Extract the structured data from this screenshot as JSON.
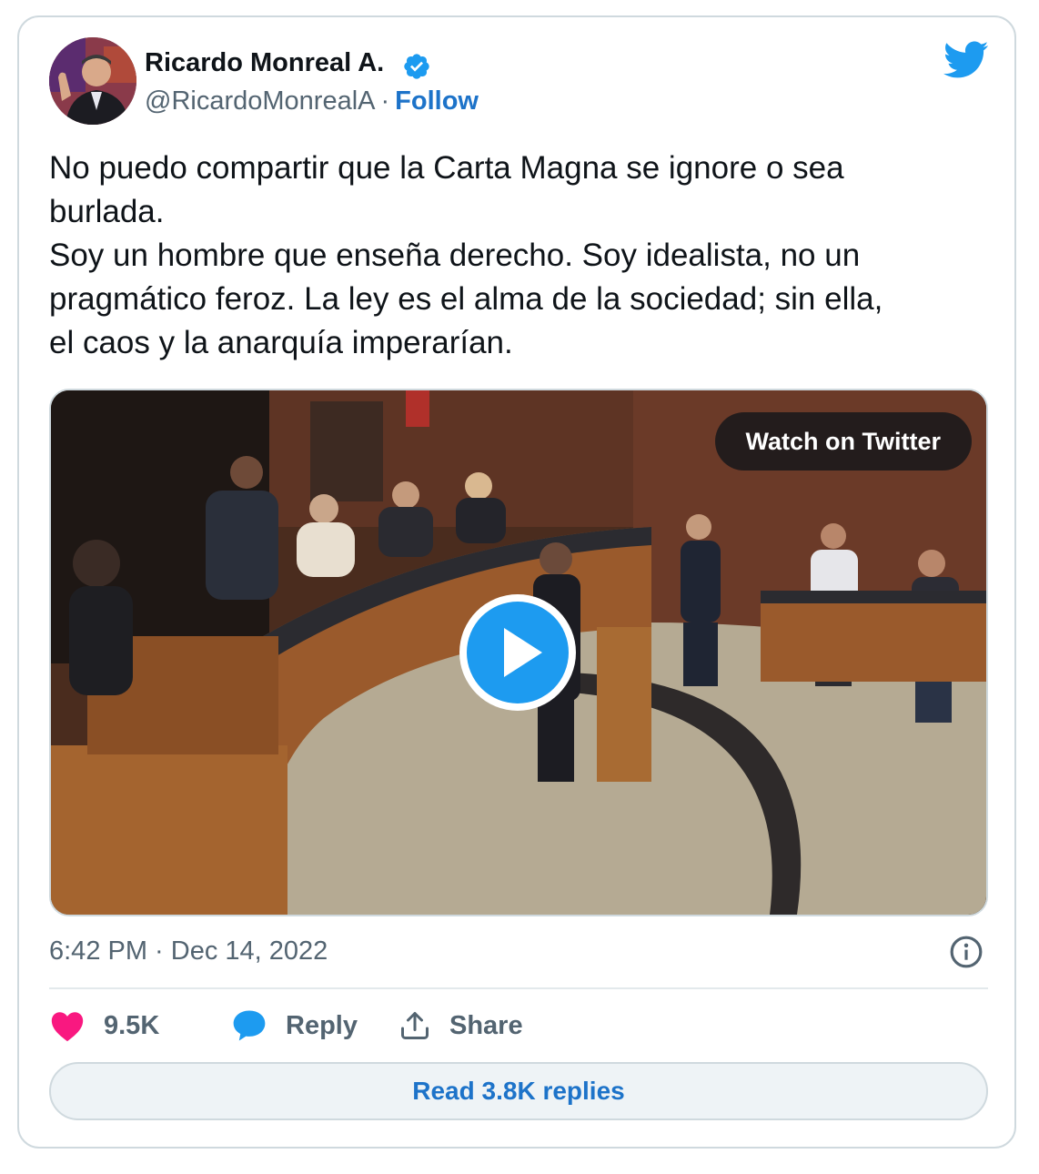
{
  "author": {
    "name": "Ricardo Monreal A.",
    "handle": "@RicardoMonrealA",
    "separator": "·",
    "follow_label": "Follow"
  },
  "tweet": {
    "lines": [
      "No puedo compartir que la Carta Magna se ignore o sea",
      "burlada.",
      "Soy un hombre que enseña derecho. Soy idealista, no un",
      "pragmático feroz. La ley es el alma de la sociedad; sin ella,",
      "el caos y la anarquía imperarían."
    ]
  },
  "media": {
    "watch_label": "Watch on Twitter"
  },
  "meta": {
    "timestamp": "6:42 PM · Dec 14, 2022"
  },
  "actions": {
    "likes_count": "9.5K",
    "reply_label": "Reply",
    "share_label": "Share"
  },
  "read_replies_label": "Read 3.8K replies",
  "colors": {
    "accent": "#1d9bf0",
    "link": "#1d73c9",
    "like": "#f91880",
    "muted": "#536471",
    "border": "#cfd9de"
  },
  "icons": [
    "verified-badge-icon",
    "twitter-bird-icon",
    "play-icon",
    "info-icon",
    "heart-icon",
    "reply-bubble-icon",
    "share-icon"
  ]
}
